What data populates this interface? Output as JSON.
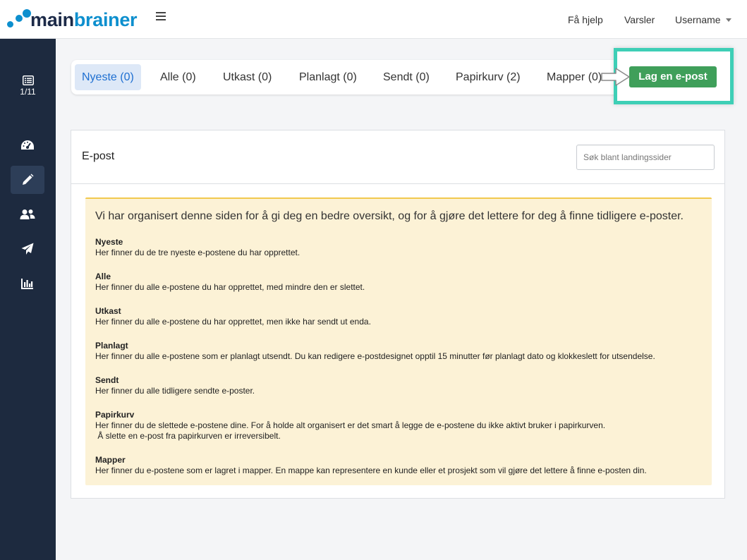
{
  "header": {
    "logo_part1": "main",
    "logo_part2": "brainer",
    "help": "Få hjelp",
    "alerts": "Varsler",
    "username": "Username"
  },
  "sidebar": {
    "counter": "1/11",
    "items": [
      "dashboard-icon",
      "pencil-icon",
      "users-icon",
      "paper-plane-icon",
      "bar-chart-icon"
    ],
    "active_index": 1
  },
  "tabs": [
    {
      "label": "Nyeste (0)",
      "active": true
    },
    {
      "label": "Alle (0)"
    },
    {
      "label": "Utkast (0)"
    },
    {
      "label": "Planlagt (0)"
    },
    {
      "label": "Sendt (0)"
    },
    {
      "label": "Papirkurv (2)"
    },
    {
      "label": "Mapper (0)"
    }
  ],
  "cta": {
    "label": "Lag en e-post",
    "highlight_color": "#3ecfb6",
    "button_color": "#3f9f5a"
  },
  "card": {
    "title": "E-post",
    "search_placeholder": "Søk blant landingssider"
  },
  "info": {
    "lead": "Vi har organisert denne siden for å gi deg en bedre oversikt, og for å gjøre det lettere for deg å finne tidligere e-poster.",
    "sections": [
      {
        "heading": "Nyeste",
        "lines": [
          "Her finner du de tre nyeste e-postene du har opprettet."
        ]
      },
      {
        "heading": "Alle",
        "lines": [
          "Her finner du alle e-postene du har opprettet, med mindre den er slettet."
        ]
      },
      {
        "heading": "Utkast",
        "lines": [
          "Her finner du alle e-postene du har opprettet, men ikke har sendt ut enda."
        ]
      },
      {
        "heading": "Planlagt",
        "lines": [
          "Her finner du alle e-postene som er planlagt utsendt. Du kan redigere e-postdesignet opptil 15 minutter før planlagt dato og klokkeslett for utsendelse."
        ]
      },
      {
        "heading": "Sendt",
        "lines": [
          "Her finner du alle tidligere sendte e-poster."
        ]
      },
      {
        "heading": "Papirkurv",
        "lines": [
          "Her finner du de slettede e-postene dine. For å holde alt organisert er det smart å legge de e-postene du ikke aktivt bruker i papirkurven.",
          " Å slette en e-post fra papirkurven er irreversibelt."
        ]
      },
      {
        "heading": "Mapper",
        "lines": [
          "Her finner du e-postene som er lagret i mapper. En mappe kan representere en kunde eller et prosjekt som vil gjøre det lettere å finne e-posten din."
        ]
      }
    ]
  }
}
